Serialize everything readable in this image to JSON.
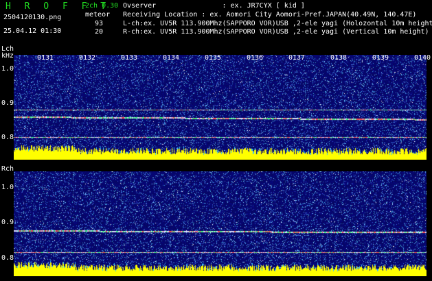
{
  "header": {
    "logo": "H R O F F T",
    "filename": "2504120130.png",
    "datetime": "25.04.12 01:30",
    "mode": "2ch 0.30",
    "meteor_label": "meteor",
    "count_l": "93",
    "count_r": "20",
    "observer": "Ovserver                : ex. JR7CYX [ kid ]",
    "location": "Receiving Location : ex. Aomori City Aomori-Pref.JAPAN(40.49N, 140.47E)",
    "lch_info": "L-ch:ex. UV5R 113.900Mhz(SAPPORO VOR)USB ,2-ele yagi (Holozontal 10m height",
    "rch_info": "R-ch:ex. UV5R 113.900Mhz(SAPPORO VOR)USB ,2-ele yagi (Vertical 10m height)"
  },
  "lch": {
    "label": "Lch",
    "unit": "kHz",
    "yticks": [
      "1.0",
      "0.9",
      "0.8"
    ]
  },
  "rch": {
    "label": "Rch",
    "yticks": [
      "1.0",
      "0.9",
      "0.8"
    ]
  },
  "time_marks": [
    "0131",
    "0132",
    "0133",
    "0134",
    "0135",
    "0136",
    "0137",
    "0138",
    "0139",
    "0140"
  ],
  "colors": {
    "text_green": "#22dd22",
    "background": "#000000",
    "noise_base": "#0a0a60",
    "level_bar": "#ffff00"
  }
}
